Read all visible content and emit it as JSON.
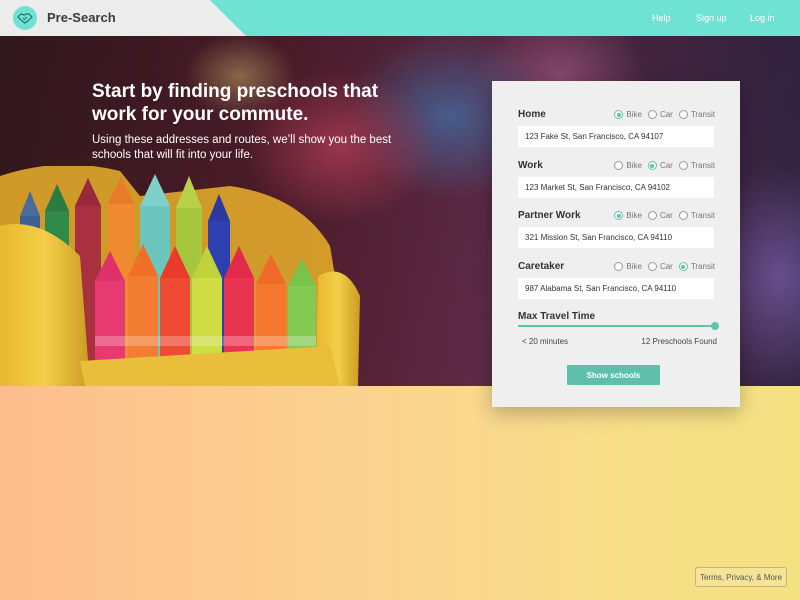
{
  "app": {
    "brand_name": "Pre-Search",
    "logo_icon": "handshake-icon"
  },
  "nav": {
    "help": "Help",
    "signup": "Sign up",
    "login": "Log in"
  },
  "hero": {
    "title": "Start by finding preschools that work for your commute.",
    "subtitle": "Using these addresses and routes, we’ll show you the best schools that will fit into your life."
  },
  "form": {
    "transport_options": [
      "Bike",
      "Car",
      "Transit"
    ],
    "locations": [
      {
        "label": "Home",
        "address": "123 Fake St, San Francisco, CA 94107",
        "selected_mode": "Bike"
      },
      {
        "label": "Work",
        "address": "123 Market St, San Francisco, CA 94102",
        "selected_mode": "Car"
      },
      {
        "label": "Partner Work",
        "address": "321 Mission St, San Francisco, CA 94110",
        "selected_mode": "Bike"
      },
      {
        "label": "Caretaker",
        "address": "987 Alabama St, San Francisco, CA 94110",
        "selected_mode": "Transit"
      }
    ],
    "max_travel": {
      "label": "Max Travel Time",
      "min_label": "< 20 minutes",
      "found_label": "12 Preschools Found",
      "slider_value": 1.0
    },
    "submit_label": "Show schools"
  },
  "footer": {
    "terms": "Terms, Privacy, & More"
  },
  "colors": {
    "accent": "#5fc4ad",
    "topbar": "#6fe3d3",
    "brand_bg": "#ececec"
  }
}
